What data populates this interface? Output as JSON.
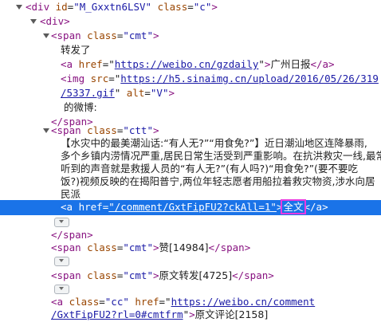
{
  "lines": {
    "l1": {
      "tag_open": "<div",
      "attr1": "id",
      "val1": "\"M_Gxxtn6LSV\"",
      "attr2": "class",
      "val2": "\"c\"",
      "tag_close": ">"
    },
    "l2": {
      "tag": "<div>"
    },
    "l3": {
      "tag_open": "<span",
      "attr": "class",
      "val": "\"cmt\"",
      "tag_close": ">"
    },
    "l4": {
      "text": "转发了"
    },
    "l5": {
      "tag_open": "<a",
      "attr": "href",
      "val": "https://weibo.cn/gzdaily",
      "tail_text": "广州日报",
      "close": "</a>"
    },
    "l6": {
      "tag_open": "<img",
      "attr": "src",
      "val_a": "https://h5.sinaimg.cn/upload/2016/05/26/319",
      "val_b": "/5337.gif",
      "attr2": "alt",
      "val2": "\"V\"",
      "tag_close": ">"
    },
    "l8": {
      "text": "的微博:"
    },
    "l9": {
      "tag": "</span>"
    },
    "l10": {
      "tag_open": "<span",
      "attr": "class",
      "val": "\"ctt\"",
      "tag_close": ">"
    },
    "para": [
      "【水灾中的最美潮汕话:“有人无?”“用食免?”】近日潮汕地区连降暴雨,",
      "多个乡镇内涝情况严重,居民日常生活受到严重影响。在抗洪救灾一线,最常",
      "听到的声音就是救援人员的“有人无?”(有人吗?)“用食免?”(要不要吃",
      "饭?)视频反映的在揭阳普宁,两位年轻志愿者用船拉着救灾物资,涉水向居",
      "民派"
    ],
    "sel": {
      "tag_open": "<a",
      "attr": "href",
      "val": "\"/comment/GxtFipFU2?ckAll=1\"",
      "gt": ">",
      "text": "全文",
      "close": "</a>"
    },
    "l20": {
      "tag": "</span>"
    },
    "l21": {
      "tag_open": "<span",
      "attr": "class",
      "val": "\"cmt\"",
      "text": "赞[14984]",
      "close": "</span>"
    },
    "l22": {
      "tag_open": "<span",
      "attr": "class",
      "val": "\"cmt\"",
      "text": "原文转发[4725]",
      "close": "</span>"
    },
    "l23": {
      "tag_open": "<a",
      "attr": "class",
      "val": "\"cc\"",
      "attr2": "href",
      "val2": "https://weibo.cn/comment",
      "val2b": "/GxtFipFU2?rl=0#cmtfrm",
      "text": "原文评论[2158]"
    }
  }
}
